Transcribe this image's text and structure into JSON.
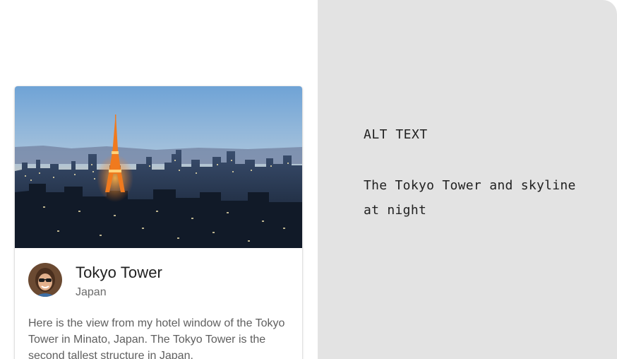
{
  "card": {
    "title": "Tokyo Tower",
    "subtitle": "Japan",
    "body": "Here is the view from my hotel window of the Tokyo Tower in Minato, Japan. The Tokyo Tower is the second tallest structure in Japan."
  },
  "alt_panel": {
    "label": "ALT TEXT",
    "text": "The Tokyo Tower and skyline at night"
  },
  "colors": {
    "panel_background": "#e3e3e3",
    "card_background": "#ffffff",
    "title_text": "#1f1f1f",
    "secondary_text": "#6b6b6b",
    "tower_glow": "#f07a1e"
  }
}
